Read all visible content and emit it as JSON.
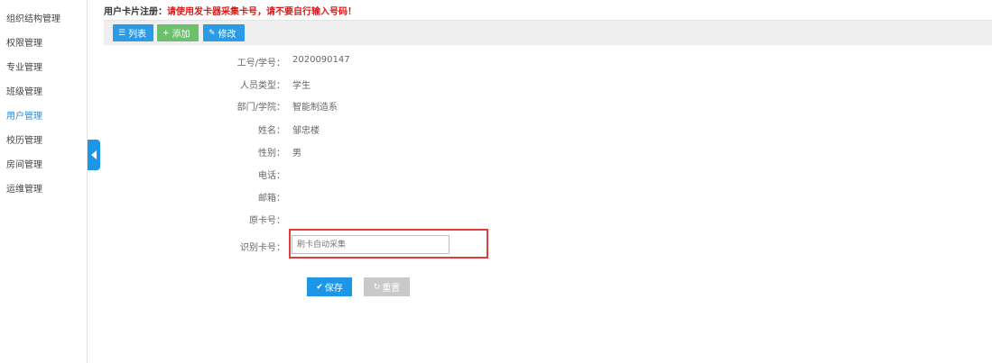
{
  "sidebar": {
    "items": [
      {
        "label": "组织结构管理"
      },
      {
        "label": "权限管理"
      },
      {
        "label": "专业管理"
      },
      {
        "label": "班级管理"
      },
      {
        "label": "用户管理"
      },
      {
        "label": "校历管理"
      },
      {
        "label": "房间管理"
      },
      {
        "label": "运维管理"
      }
    ],
    "active_index": 4
  },
  "header": {
    "notice_label": "用户卡片注册：",
    "notice_warning": "请使用发卡器采集卡号，请不要自行输入号码！"
  },
  "toolbar": {
    "list_label": "列表",
    "add_label": "添加",
    "edit_label": "修改"
  },
  "form": {
    "fields": [
      {
        "label": "工号/学号：",
        "value": "2020090147"
      },
      {
        "label": "人员类型：",
        "value": "学生"
      },
      {
        "label": "部门/学院：",
        "value": "智能制造系"
      },
      {
        "label": "姓名：",
        "value": "邹忠楼"
      },
      {
        "label": "性别：",
        "value": "男"
      },
      {
        "label": "电话：",
        "value": ""
      },
      {
        "label": "邮箱：",
        "value": ""
      },
      {
        "label": "原卡号：",
        "value": ""
      }
    ],
    "card_label": "识别卡号：",
    "card_placeholder": "刷卡自动采集",
    "card_value": ""
  },
  "actions": {
    "save_label": "保存",
    "reset_label": "重置"
  },
  "colors": {
    "primary": "#1e96e8",
    "success": "#6cc06c",
    "warning_text": "#e01818",
    "highlight_border": "#e23b3b",
    "disabled": "#c9c9c9"
  },
  "icons": {
    "list": "list-icon",
    "add": "plus-icon",
    "edit": "pencil-icon",
    "save": "check-icon",
    "reset": "refresh-icon",
    "collapse": "caret-left-icon"
  }
}
